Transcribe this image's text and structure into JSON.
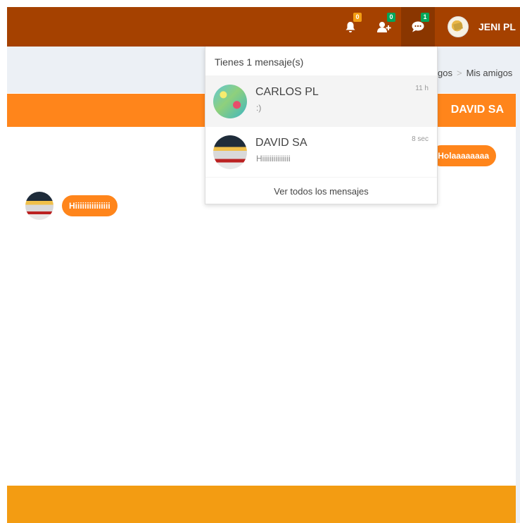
{
  "navbar": {
    "notifications_count": "0",
    "friend_requests_count": "0",
    "messages_count": "1",
    "user_name": "JENI PL"
  },
  "breadcrumb": {
    "items": [
      "gos",
      "Mis amigos"
    ],
    "separator": ">"
  },
  "chat": {
    "title": "DAVID SA",
    "messages": [
      {
        "side": "right",
        "text": "Holaaaaaaaa"
      },
      {
        "side": "left",
        "text": "Hiiiiiiiiiiiiiii"
      }
    ]
  },
  "messages_dropdown": {
    "header": "Tienes 1 mensaje(s)",
    "items": [
      {
        "name": "CARLOS PL",
        "text": ":)",
        "time": "11 h"
      },
      {
        "name": "DAVID SA",
        "text": "Hiiiiiiiiiiiiiii",
        "time": "8 sec"
      }
    ],
    "footer": "Ver todos los mensajes"
  },
  "colors": {
    "navbar": "#a54100",
    "chat_header": "#ff851b",
    "chat_footer": "#f39c12",
    "content_bg": "#ecf0f5"
  }
}
